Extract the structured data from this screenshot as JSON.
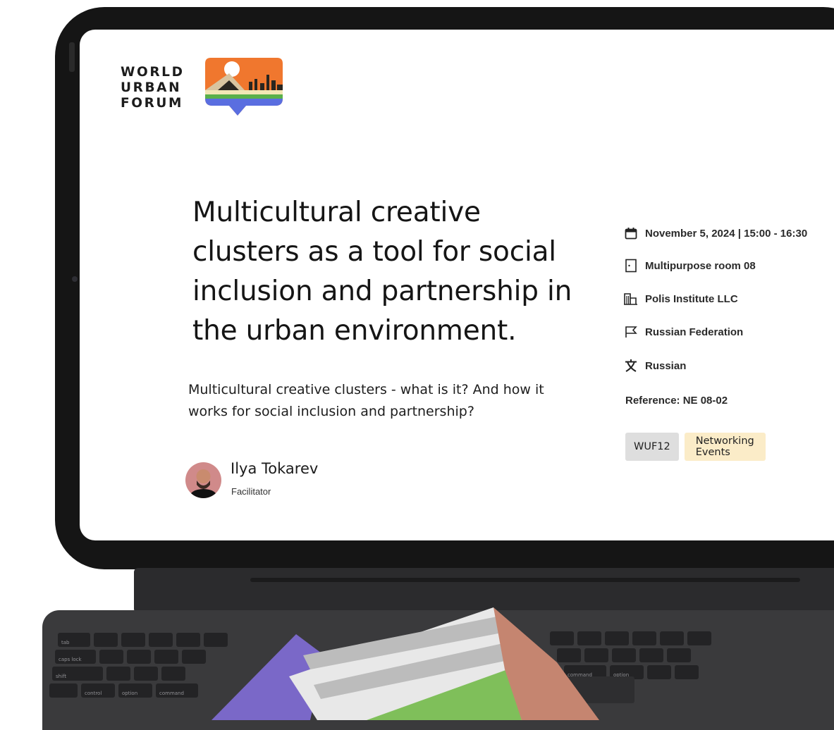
{
  "logo": {
    "lines": [
      "WORLD",
      "URBAN",
      "FORUM"
    ]
  },
  "event": {
    "title": "Multicultural creative clusters as a tool for social inclusion and partnership in the urban environment.",
    "description": "Multicultural creative clusters - what is it? And how it works for social inclusion and partnership?"
  },
  "speaker": {
    "name": "Ilya Tokarev",
    "role": "Facilitator"
  },
  "details": {
    "datetime": {
      "icon": "calendar-icon",
      "text": "November 5, 2024 | 15:00 - 16:30"
    },
    "room": {
      "icon": "door-icon",
      "text": "Multipurpose room 08"
    },
    "organizer": {
      "icon": "building-icon",
      "text": "Polis Institute LLC"
    },
    "country": {
      "icon": "flag-icon",
      "text": "Russian Federation"
    },
    "language": {
      "icon": "translate-icon",
      "text": "Russian"
    },
    "reference": "Reference: NE 08-02"
  },
  "tags": {
    "primary": "WUF12",
    "category": "Networking Events"
  },
  "colors": {
    "tag_primary_bg": "#dedede",
    "tag_category_bg": "#fbecc8",
    "logo_orange": "#f0772e",
    "logo_blue": "#5a6ee0",
    "logo_green": "#5ab04a"
  }
}
